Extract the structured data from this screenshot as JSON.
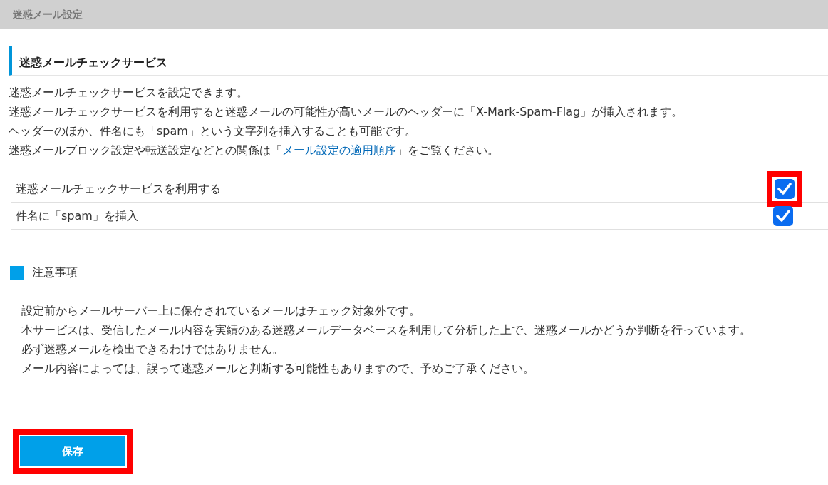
{
  "header": {
    "title": "迷惑メール設定"
  },
  "section": {
    "title": "迷惑メールチェックサービス",
    "description": [
      "迷惑メールチェックサービスを設定できます。",
      "迷惑メールチェックサービスを利用すると迷惑メールの可能性が高いメールのヘッダーに「X-Mark-Spam-Flag」が挿入されます。",
      "ヘッダーのほか、件名にも「spam」という文字列を挿入することも可能です。"
    ],
    "link_line": {
      "before": "迷惑メールブロック設定や転送設定などとの関係は「",
      "link": "メール設定の適用順序",
      "after": "」をご覧ください。"
    },
    "options": [
      {
        "label": "迷惑メールチェックサービスを利用する",
        "checked": true,
        "highlighted": true
      },
      {
        "label": "件名に「spam」を挿入",
        "checked": true,
        "highlighted": false
      }
    ]
  },
  "notes": {
    "title": "注意事項",
    "lines": [
      "設定前からメールサーバー上に保存されているメールはチェック対象外です。",
      "本サービスは、受信したメール内容を実績のある迷惑メールデータベースを利用して分析した上で、迷惑メールかどうか判断を行っています。",
      "必ず迷惑メールを検出できるわけではありません。",
      "メール内容によっては、誤って迷惑メールと判断する可能性もありますので、予めご了承ください。"
    ]
  },
  "save_button": {
    "label": "保存",
    "highlighted": true
  }
}
